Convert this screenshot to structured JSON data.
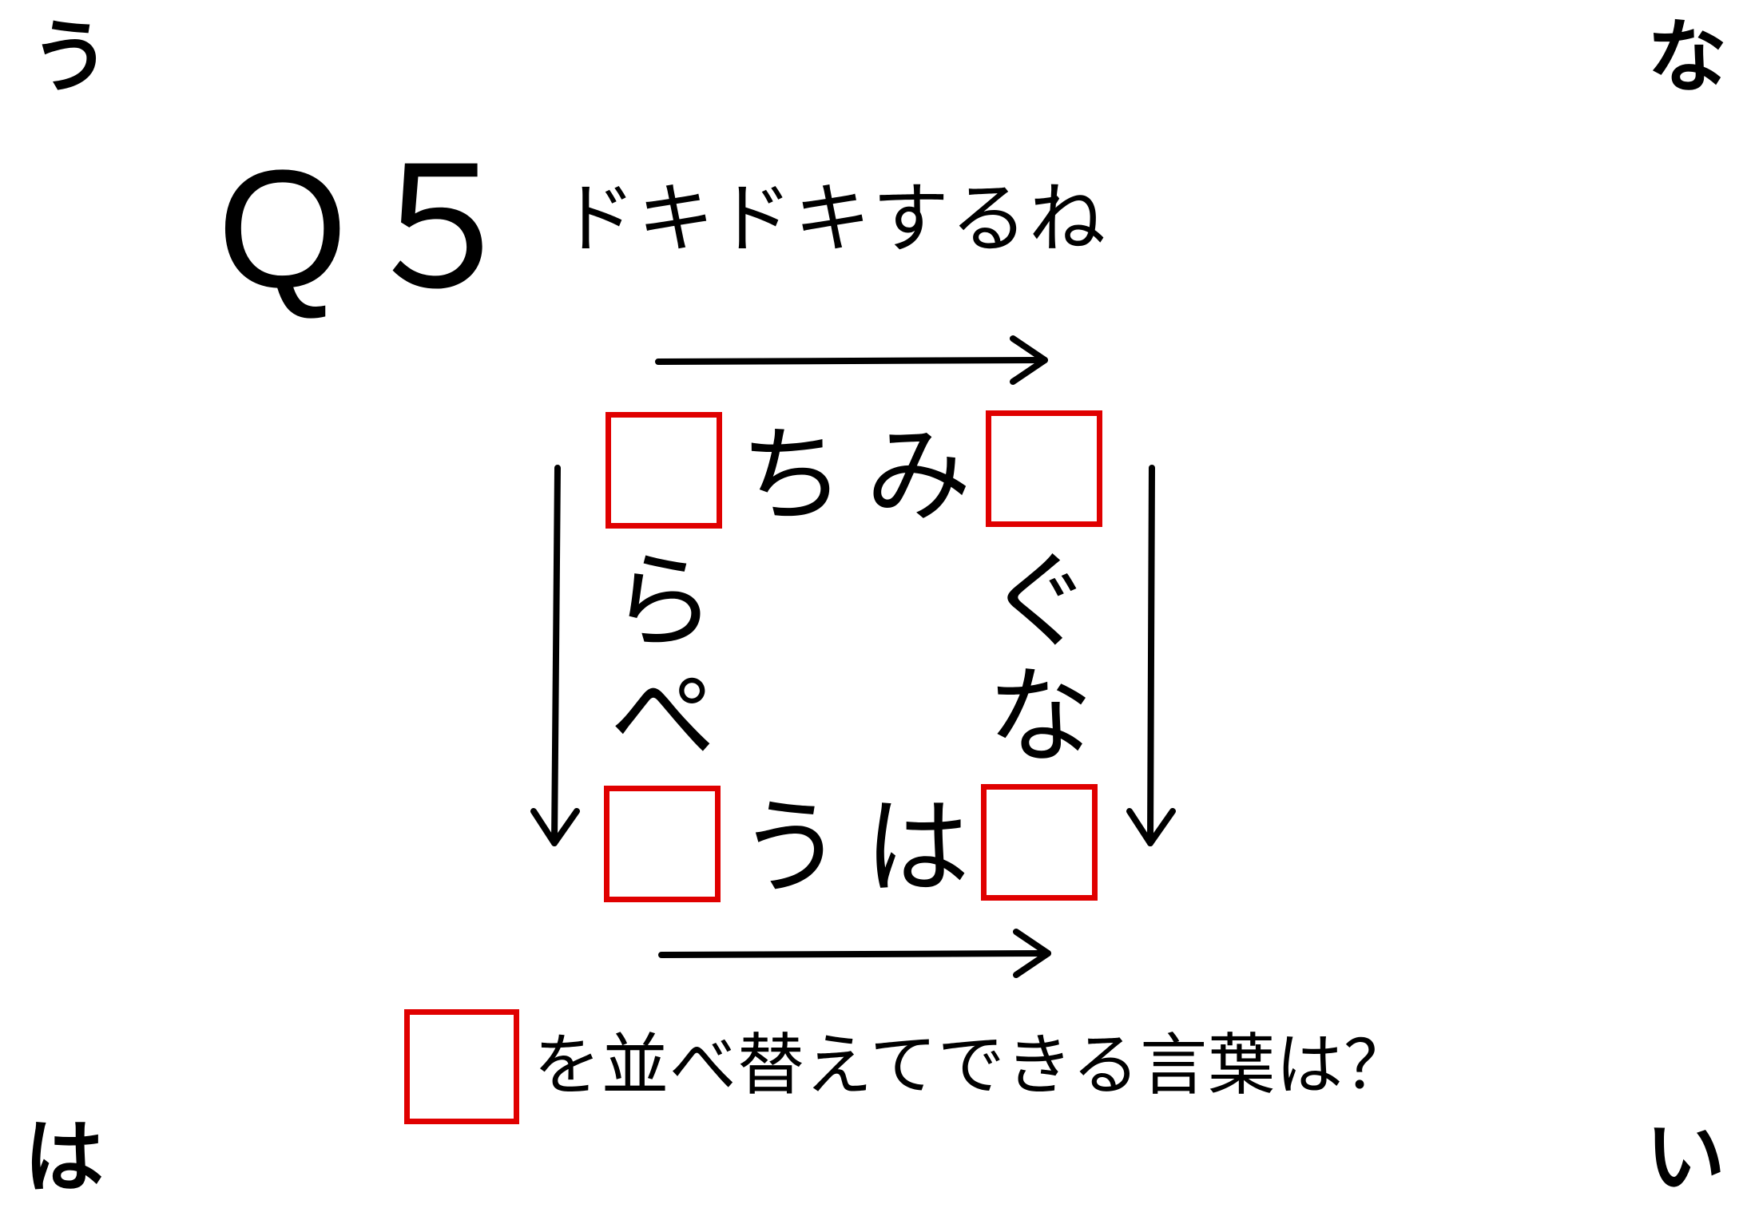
{
  "corners": {
    "top_left": "う",
    "top_right": "な",
    "bottom_left": "は",
    "bottom_right": "い"
  },
  "question": {
    "label": "Q５",
    "hint": "ドキドキするね"
  },
  "puzzle": {
    "top_row": [
      "ち",
      "み"
    ],
    "left_column": [
      "ら",
      "ぺ"
    ],
    "right_column": [
      "ぐ",
      "な"
    ],
    "bottom_row": [
      "う",
      "は"
    ]
  },
  "instruction": "を並べ替えてできる言葉は？",
  "colors": {
    "box_border": "#e00000",
    "text": "#000000",
    "background": "#ffffff"
  }
}
